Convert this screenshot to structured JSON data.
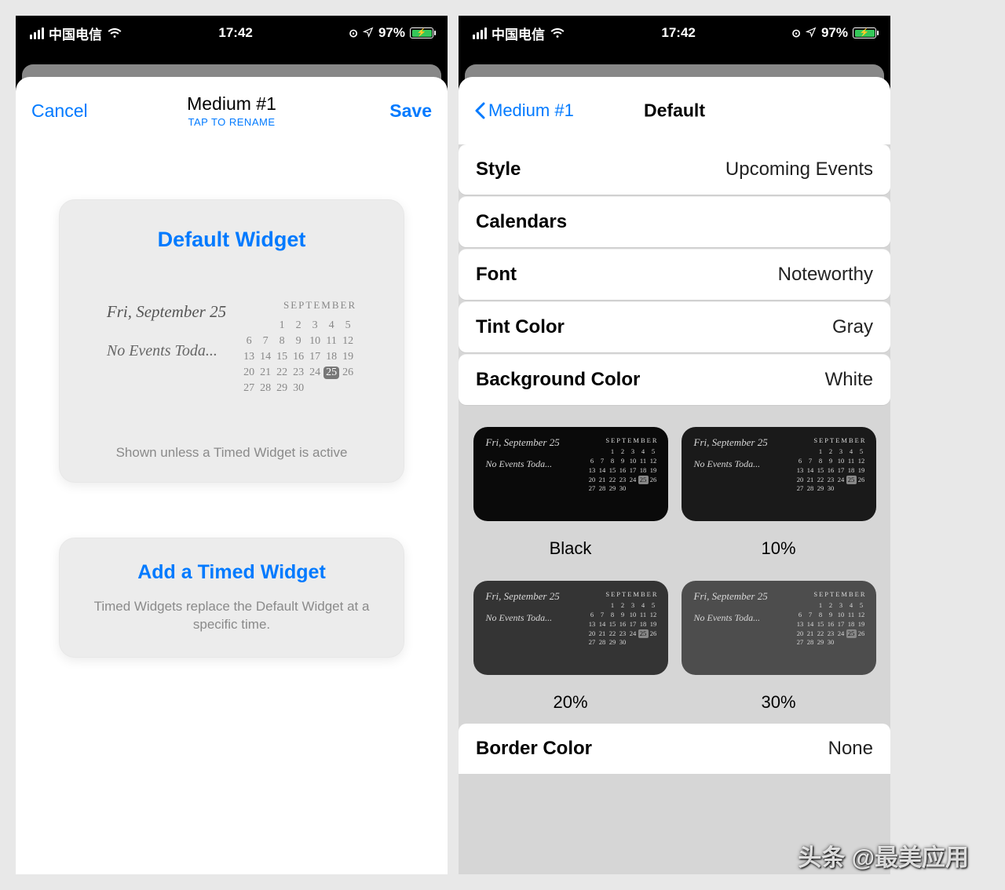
{
  "status": {
    "carrier": "中国电信",
    "time": "17:42",
    "battery_pct": "97%"
  },
  "left": {
    "nav": {
      "cancel": "Cancel",
      "title": "Medium #1",
      "subtitle": "TAP TO RENAME",
      "save": "Save"
    },
    "defaultCard": {
      "title": "Default Widget",
      "dateLine": "Fri, September 25",
      "noEvents": "No Events Toda...",
      "month": "SEPTEMBER",
      "footer": "Shown unless a Timed Widget is active"
    },
    "addCard": {
      "title": "Add a Timed Widget",
      "desc": "Timed Widgets replace the Default Widget at a specific time."
    }
  },
  "right": {
    "nav": {
      "back": "Medium #1",
      "title": "Default"
    },
    "rows": {
      "style": {
        "label": "Style",
        "value": "Upcoming Events"
      },
      "calendars": {
        "label": "Calendars",
        "value": ""
      },
      "font": {
        "label": "Font",
        "value": "Noteworthy"
      },
      "tint": {
        "label": "Tint Color",
        "value": "Gray"
      },
      "bg": {
        "label": "Background Color",
        "value": "White"
      },
      "border": {
        "label": "Border Color",
        "value": "None"
      }
    },
    "swatches": {
      "date": "Fri, September 25",
      "noEvents": "No Events Toda...",
      "month": "SEPTEMBER",
      "labels": {
        "black": "Black",
        "p10": "10%",
        "p20": "20%",
        "p30": "30%"
      }
    }
  },
  "calendar": {
    "weeks": [
      [
        "",
        "",
        "1",
        "2",
        "3",
        "4",
        "5"
      ],
      [
        "6",
        "7",
        "8",
        "9",
        "10",
        "11",
        "12"
      ],
      [
        "13",
        "14",
        "15",
        "16",
        "17",
        "18",
        "19"
      ],
      [
        "20",
        "21",
        "22",
        "23",
        "24",
        "25",
        "26"
      ],
      [
        "27",
        "28",
        "29",
        "30",
        "",
        "",
        ""
      ]
    ],
    "today": "25"
  },
  "watermark": "头条 @最美应用"
}
